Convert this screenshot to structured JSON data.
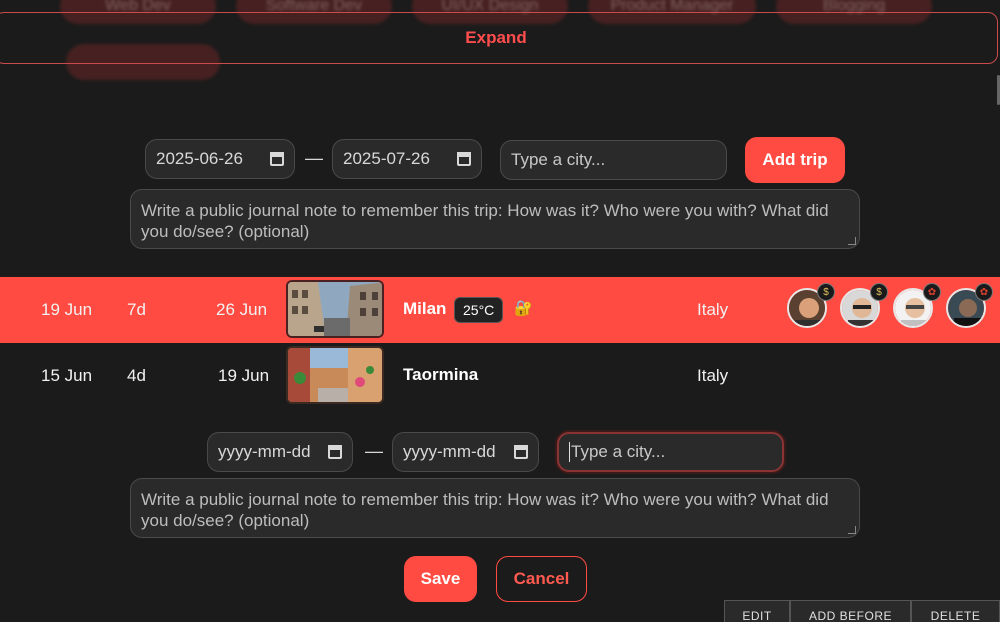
{
  "tags": [
    "Web Dev",
    "Software Dev",
    "UI/UX Design",
    "Product Manager",
    "Blogging"
  ],
  "expand_label": "Expand",
  "new_trip": {
    "start_date": "2025-06-26",
    "end_date": "2025-07-26",
    "city_placeholder": "Type a city...",
    "add_label": "Add trip",
    "note_placeholder": "Write a public journal note to remember this trip: How was it? Who were you with? What did you do/see? (optional)"
  },
  "separator": "—",
  "trips": [
    {
      "start": "19 Jun",
      "duration": "7d",
      "end": "26 Jun",
      "city": "Milan",
      "temperature": "25°C",
      "country": "Italy",
      "active": true
    },
    {
      "start": "15 Jun",
      "duration": "4d",
      "end": "19 Jun",
      "city": "Taormina",
      "temperature": "",
      "country": "Italy",
      "active": false
    }
  ],
  "edit_trip": {
    "start_placeholder": "yyyy-mm-dd",
    "end_placeholder": "yyyy-mm-dd",
    "city_placeholder": "Type a city...",
    "note_placeholder": "Write a public journal note to remember this trip: How was it? Who were you with? What did you do/see? (optional)",
    "save_label": "Save",
    "cancel_label": "Cancel"
  },
  "row_actions": [
    "EDIT",
    "ADD BEFORE",
    "DELETE"
  ],
  "colors": {
    "accent": "#ff4b42",
    "background": "#1b1b1b",
    "field": "#2a2a2a"
  }
}
